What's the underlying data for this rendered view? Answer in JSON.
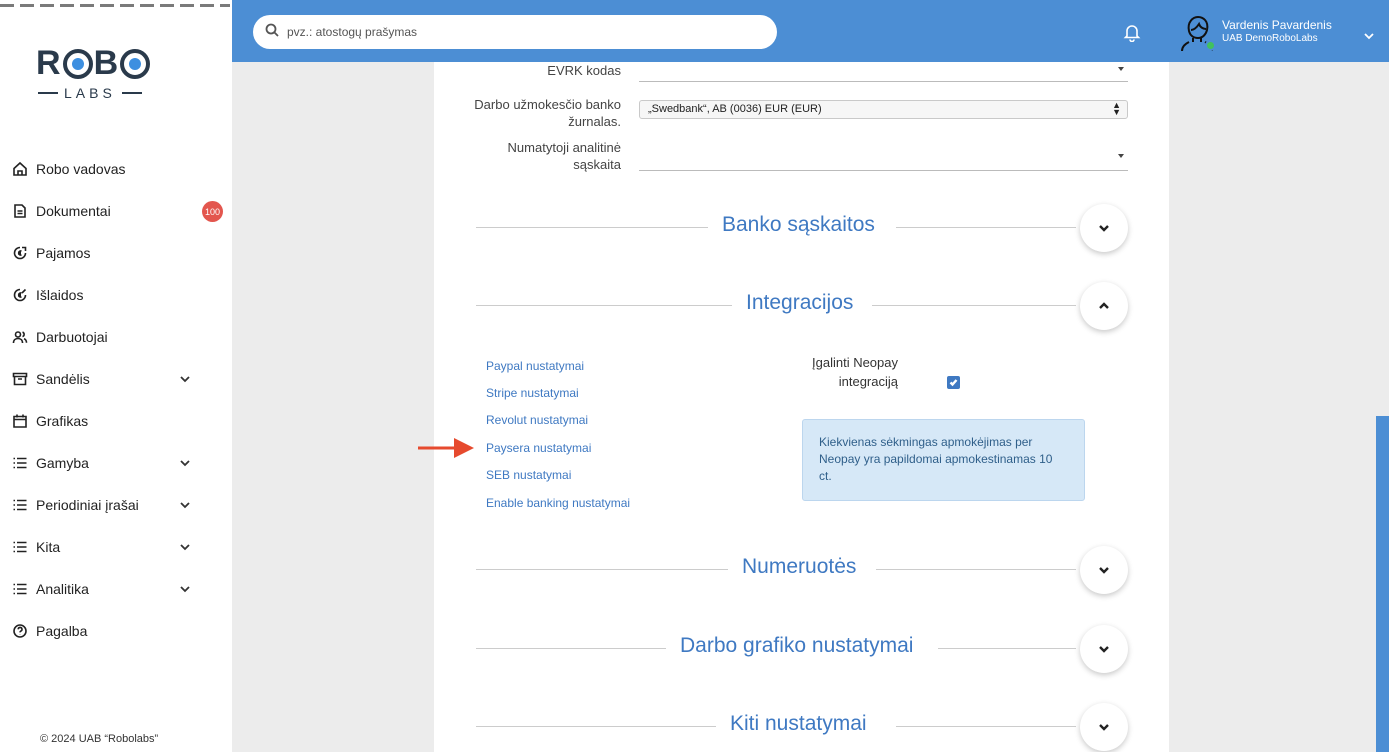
{
  "brand": {
    "logo_main": "R",
    "logo_mid": "B",
    "logo_sub": "LABS"
  },
  "sidebar": {
    "items": [
      {
        "label": "Robo vadovas",
        "icon": "home-icon"
      },
      {
        "label": "Dokumentai",
        "icon": "document-icon",
        "badge": "100"
      },
      {
        "label": "Pajamos",
        "icon": "income-icon"
      },
      {
        "label": "Išlaidos",
        "icon": "expenses-icon"
      },
      {
        "label": "Darbuotojai",
        "icon": "people-icon"
      },
      {
        "label": "Sandėlis",
        "icon": "warehouse-icon",
        "expandable": true
      },
      {
        "label": "Grafikas",
        "icon": "calendar-icon"
      },
      {
        "label": "Gamyba",
        "icon": "list-icon",
        "expandable": true
      },
      {
        "label": "Periodiniai įrašai",
        "icon": "list-icon",
        "expandable": true
      },
      {
        "label": "Kita",
        "icon": "list-icon",
        "expandable": true
      },
      {
        "label": "Analitika",
        "icon": "list-icon",
        "expandable": true
      },
      {
        "label": "Pagalba",
        "icon": "help-icon"
      }
    ],
    "copyright": "© 2024 UAB “Robolabs”"
  },
  "header": {
    "search_placeholder": "pvz.: atostogų prašymas",
    "user_name": "Vardenis Pavardenis",
    "user_company": "UAB DemoRoboLabs",
    "accent_color": "#4c8ed4"
  },
  "form": {
    "evrk_label": "EVRK kodas",
    "bank_journal_label": "Darbo užmokesčio banko žurnalas.",
    "bank_journal_value": "„Swedbank“, AB (0036) EUR (EUR)",
    "analytic_label": "Numatytoji analitinė sąskaita"
  },
  "sections": {
    "bank_accounts": "Banko sąskaitos",
    "integrations": "Integracijos",
    "numbering": "Numeruotės",
    "work_schedule": "Darbo grafiko nustatymai",
    "other": "Kiti nustatymai"
  },
  "integrations": {
    "links": [
      "Paypal nustatymai",
      "Stripe nustatymai",
      "Revolut nustatymai",
      "Paysera nustatymai",
      "SEB nustatymai",
      "Enable banking nustatymai"
    ],
    "neopay_label": "Įgalinti Neopay integraciją",
    "neopay_checked": true,
    "neopay_info": "Kiekvienas sėkmingas apmokėjimas per Neopay yra papildomai apmokestinamas 10 ct."
  }
}
